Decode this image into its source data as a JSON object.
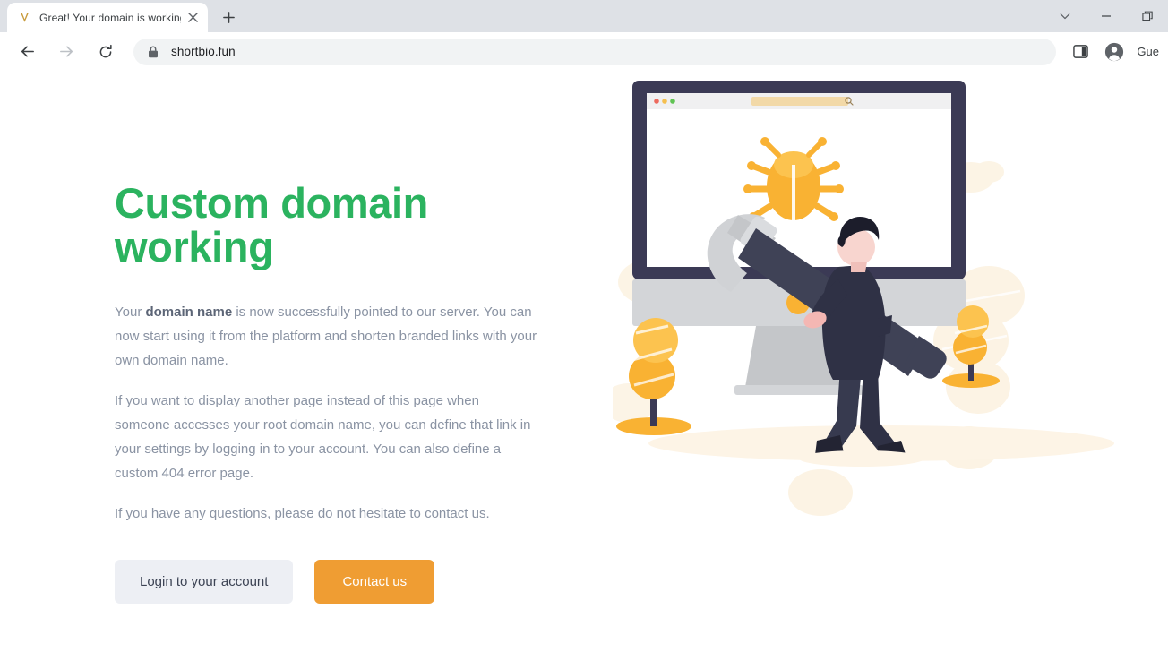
{
  "browser": {
    "tab": {
      "favicon": "v-logo-icon",
      "title": "Great! Your domain is working. -",
      "close_icon": "close-icon"
    },
    "new_tab_icon": "plus-icon",
    "window_controls": {
      "tab_search_icon": "chevron-down-icon",
      "minimize_icon": "minimize-icon",
      "maximize_icon": "maximize-icon"
    },
    "toolbar": {
      "back_icon": "arrow-left-icon",
      "forward_icon": "arrow-right-icon",
      "reload_icon": "reload-icon",
      "lock_icon": "lock-icon",
      "url": "shortbio.fun",
      "side_panel_icon": "side-panel-icon",
      "profile_icon": "avatar-icon",
      "profile_label": "Gue"
    }
  },
  "page": {
    "title": "Custom domain working",
    "paragraphs": [
      {
        "before": "Your ",
        "bold": "domain name",
        "after": " is now successfully pointed to our server. You can now start using it from the platform and shorten branded links with your own domain name."
      },
      {
        "text": "If you want to display another page instead of this page when someone accesses your root domain name, you can define that link in your settings by logging in to your account. You can also define a custom 404 error page."
      },
      {
        "text": "If you have any questions, please do not hesitate to contact us."
      }
    ],
    "buttons": {
      "secondary_label": "Login to your account",
      "primary_label": "Contact us"
    },
    "colors": {
      "heading_green": "#2bb35f",
      "primary_orange": "#ef9d33",
      "secondary_bg": "#edeff4",
      "body_text": "#8a93a3",
      "illustration_navy": "#3b3a55",
      "illustration_yellow": "#f9b233",
      "illustration_gray": "#d0d2d5",
      "illustration_cream": "#fbf0dc"
    },
    "illustration": {
      "name": "debugging-illustration",
      "elements": [
        "monitor",
        "browser-window",
        "beetle-bug-icon",
        "person-with-hammer",
        "yellow-bush-left",
        "yellow-bush-right",
        "background-clouds"
      ],
      "browser_dots": [
        "#ed6a5e",
        "#f5bf4f",
        "#61c454"
      ],
      "search_icon": "magnifier-icon"
    }
  }
}
